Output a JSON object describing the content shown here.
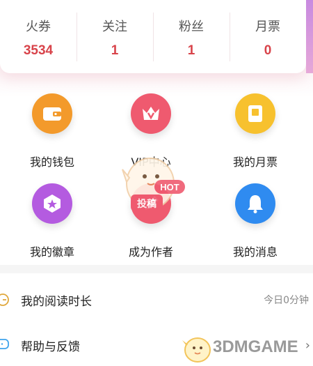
{
  "stats": [
    {
      "label": "火券",
      "value": "3534"
    },
    {
      "label": "关注",
      "value": "1"
    },
    {
      "label": "粉丝",
      "value": "1"
    },
    {
      "label": "月票",
      "value": "0"
    }
  ],
  "grid": [
    {
      "label": "我的钱包",
      "icon": "wallet-icon",
      "color": "#f39a2b"
    },
    {
      "label": "VIP中心",
      "icon": "crown-icon",
      "color": "#ef5a6f"
    },
    {
      "label": "我的月票",
      "icon": "ticket-icon",
      "color": "#f7c12e"
    },
    {
      "label": "我的徽章",
      "icon": "badge-icon",
      "color": "#b45be0"
    },
    {
      "label": "成为作者",
      "icon": "author-icon",
      "color": "#ef5a6f"
    },
    {
      "label": "我的消息",
      "icon": "bell-icon",
      "color": "#2f8bf0"
    }
  ],
  "list": {
    "reading": {
      "label": "我的阅读时长",
      "value": "今日0分钟"
    },
    "help": {
      "label": "帮助与反馈"
    }
  },
  "watermark": {
    "text": "3DMGAME",
    "badge": "HOT",
    "mascot_text": "投稿"
  }
}
